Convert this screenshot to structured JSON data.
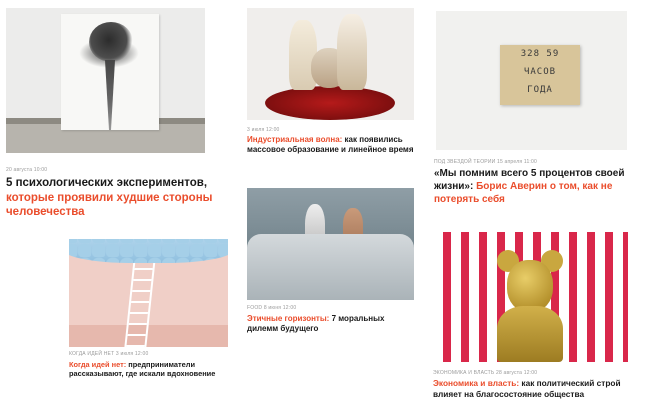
{
  "cards": [
    {
      "meta": "20 августа 10:00",
      "title_dark": "5 психологических экспериментов, ",
      "title_accent": "которые проявили худшие стороны человечества"
    },
    {
      "meta": "3 июля 12:00",
      "title_accent": "Индустриальная волна:",
      "title_dark": " как появились массовое образование и линейное время"
    },
    {
      "meta": "ПОД ЗВЕЗДОЙ ТЕОРИИ 15 апреля 11:00",
      "title_dark": "«Мы помним всего 5 процентов своей жизни»: ",
      "title_accent": "Борис Аверин о том, как не потерять себя",
      "clock_rows": [
        "328 59",
        "ЧАСОВ",
        "ГОДА"
      ]
    },
    {
      "meta": "КОГДА ИДЕЙ НЕТ 3 июля 12:00",
      "title_accent": "Когда идей нет:",
      "title_dark": " предприниматели рассказывают, где искали вдохновение"
    },
    {
      "meta": "FOOD 8 июня 12:00",
      "title_accent": "Этичные горизонты:",
      "title_dark": " 7 моральных дилемм будущего"
    },
    {
      "meta": "ЭКОНОМИКА И ВЛАСТЬ 28 августа 12:00",
      "title_accent": "Экономика и власть:",
      "title_dark": " как политический строй влияет на благосостояние общества"
    }
  ],
  "colors": {
    "accent": "#ea4d2c",
    "text": "#1a1a1a",
    "meta": "#9a9a9a"
  }
}
